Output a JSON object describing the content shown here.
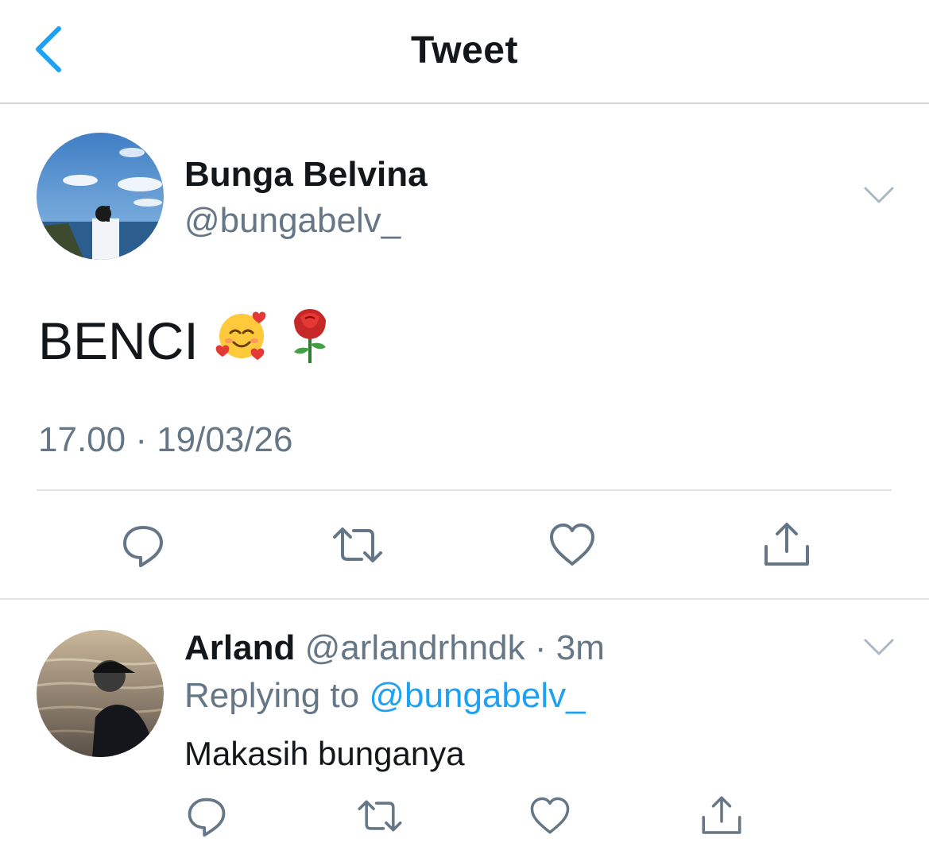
{
  "header": {
    "title": "Tweet",
    "back_icon": "chevron-left-icon"
  },
  "colors": {
    "accent": "#1da1f2",
    "secondary_text": "#657786",
    "primary_text": "#14171a",
    "divider": "#e1e4e7"
  },
  "main_tweet": {
    "display_name": "Bunga Belvina",
    "handle": "@bungabelv_",
    "text": "BENCI",
    "emojis": [
      "smiling-face-with-hearts",
      "rose"
    ],
    "timestamp": "17.00 · 19/03/26",
    "actions": [
      "reply-icon",
      "retweet-icon",
      "like-icon",
      "share-icon"
    ]
  },
  "reply_tweet": {
    "display_name": "Arland",
    "handle_time": "@arlandrhndk · 3m",
    "replying_to_label": "Replying to",
    "replying_to_handle": "@bungabelv_",
    "text": "Makasih bunganya",
    "actions": [
      "reply-icon",
      "retweet-icon",
      "like-icon",
      "share-icon"
    ]
  }
}
